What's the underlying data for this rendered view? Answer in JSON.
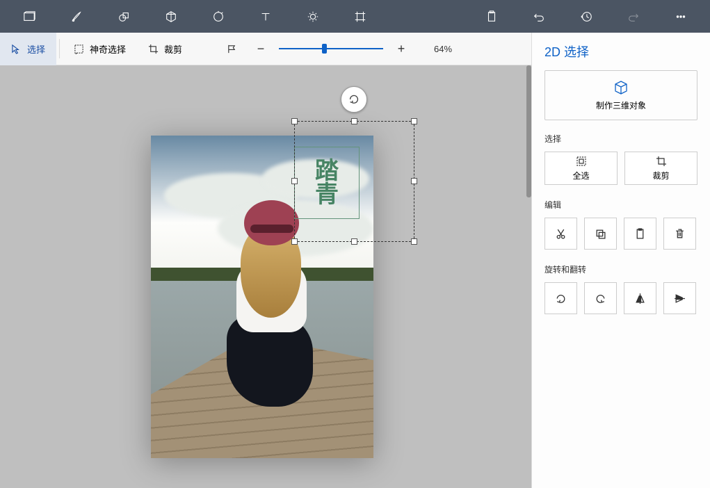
{
  "ribbon": {
    "items": [
      "menu",
      "brush",
      "shapes2d",
      "shapes3d",
      "stickers",
      "text",
      "effects",
      "crop",
      "clipboard",
      "undo",
      "history",
      "redo",
      "more"
    ]
  },
  "toolbar": {
    "select": "选择",
    "magic_select": "神奇选择",
    "crop": "裁剪",
    "zoom_value": "64%"
  },
  "panel": {
    "title": "2D 选择",
    "make3d": "制作三维对象",
    "sections": {
      "select": "选择",
      "edit": "编辑",
      "rotate": "旋转和翻转"
    },
    "select_all": "全选",
    "crop": "裁剪"
  },
  "canvas": {
    "overlay_text_1": "踏",
    "overlay_text_2": "青"
  }
}
